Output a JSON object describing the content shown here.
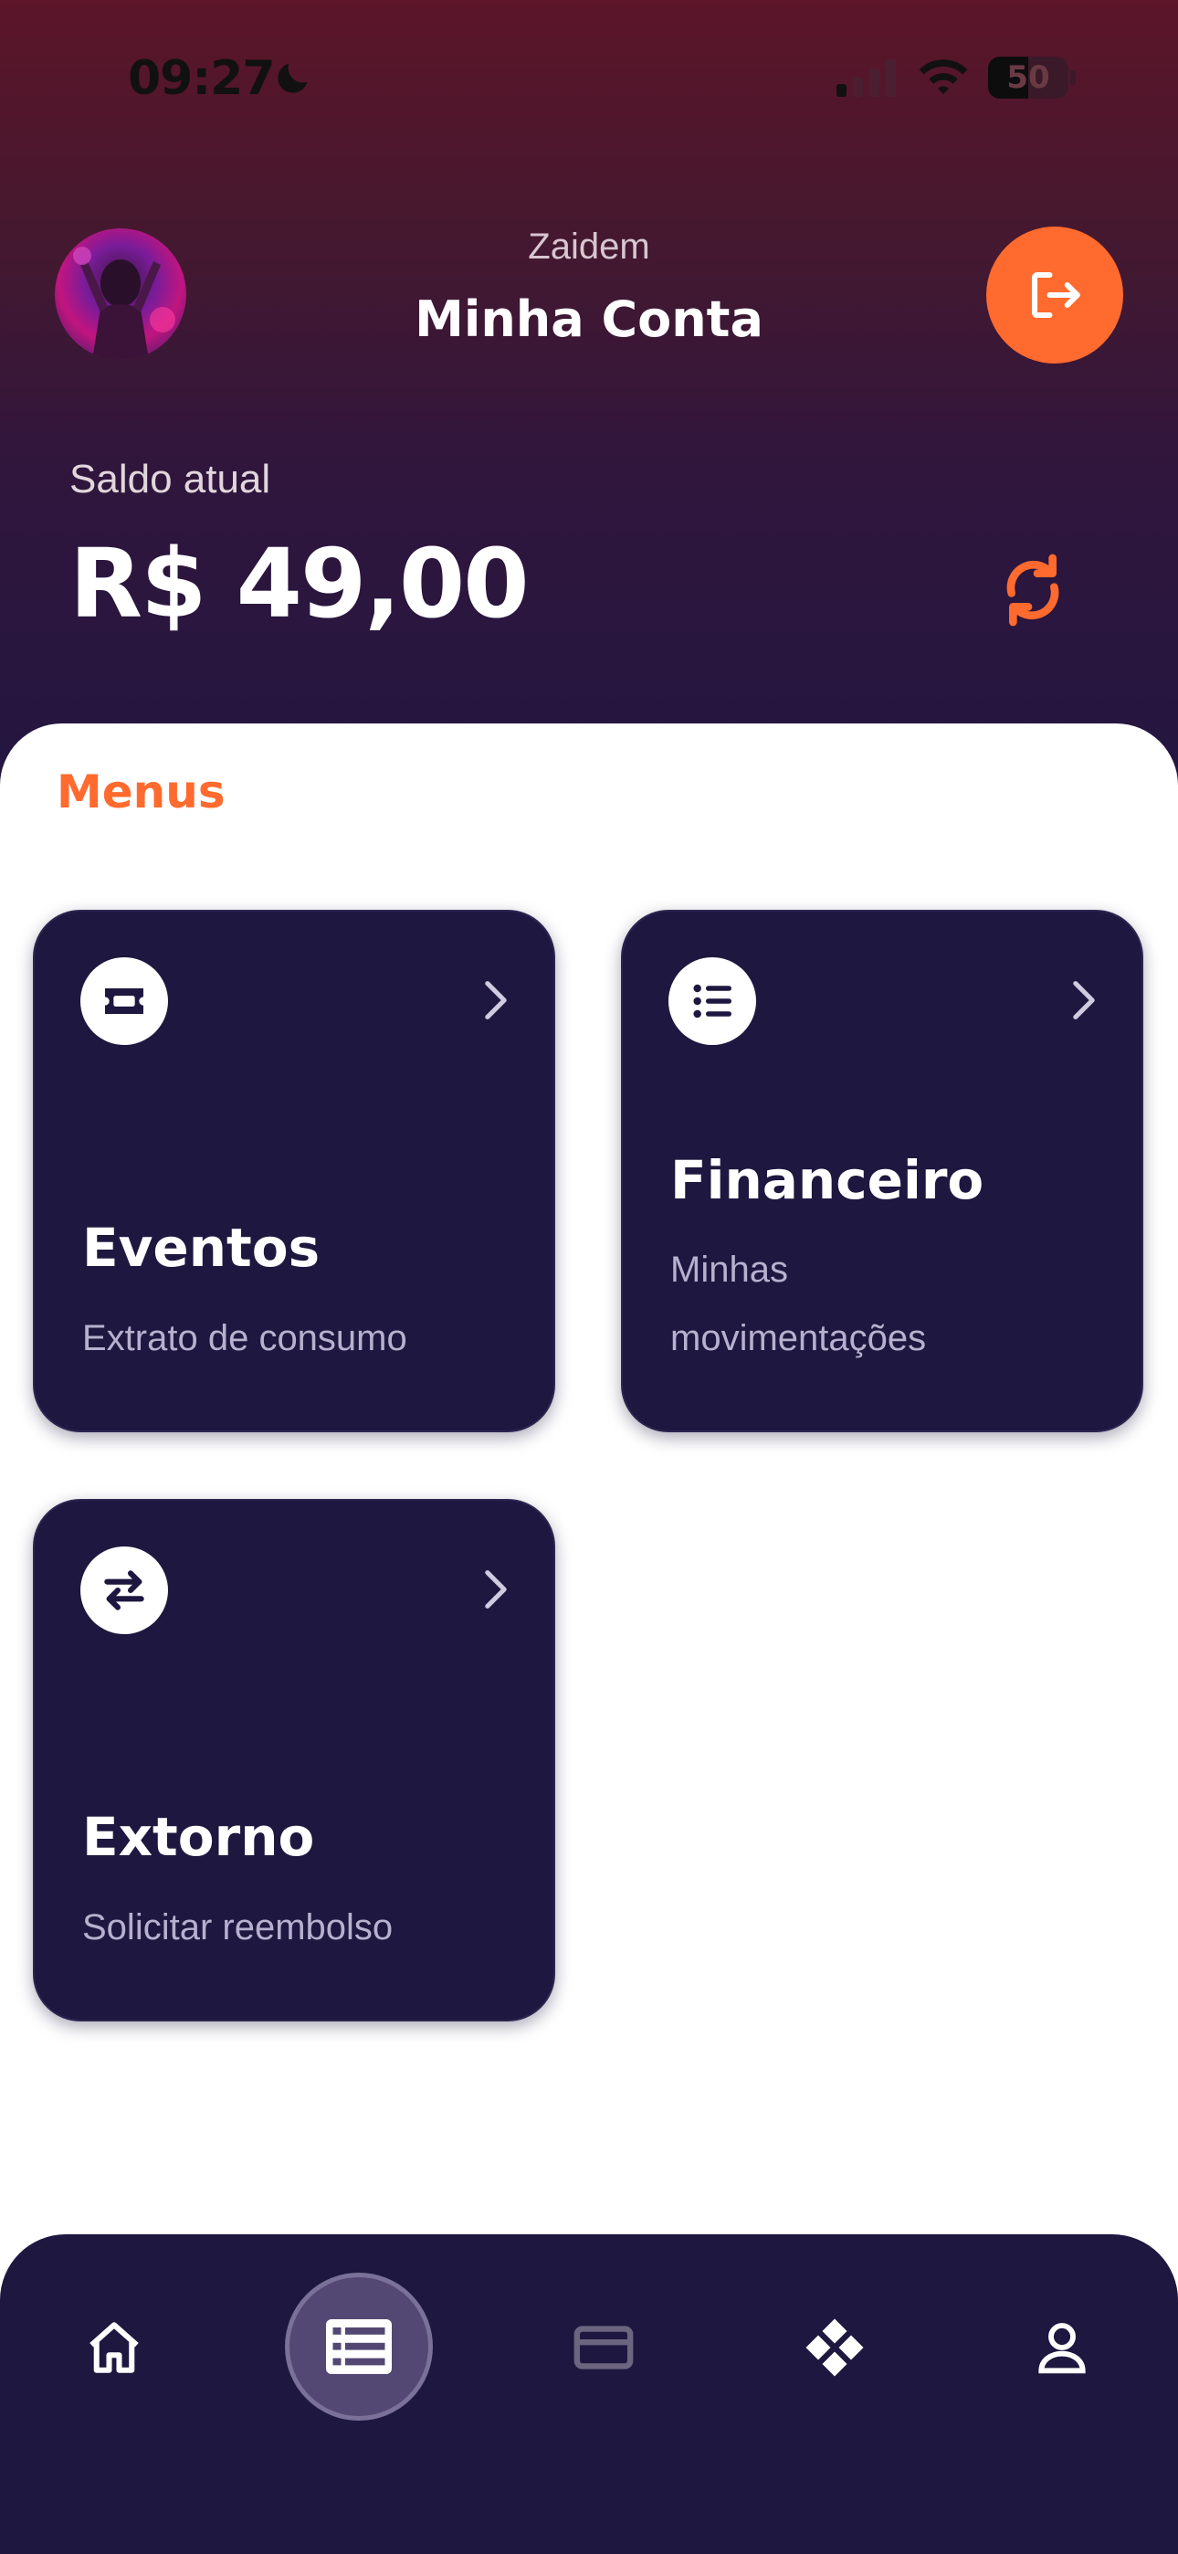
{
  "status_bar": {
    "time": "09:27",
    "battery": "50",
    "battery_level": 0.5
  },
  "header": {
    "username": "Zaidem",
    "title": "Minha Conta",
    "logout_icon": "logout-icon",
    "avatar_icon": "avatar"
  },
  "balance": {
    "label": "Saldo atual",
    "value": "R$ 49,00",
    "refresh_icon": "refresh-icon"
  },
  "menus": {
    "title": "Menus",
    "cards": [
      {
        "title": "Eventos",
        "subtitle": "Extrato de consumo",
        "icon": "ticket-icon"
      },
      {
        "title": "Financeiro",
        "subtitle": "Minhas movimentações",
        "icon": "list-icon"
      },
      {
        "title": "Extorno",
        "subtitle": "Solicitar reembolso",
        "icon": "swap-arrows-icon"
      }
    ]
  },
  "bottom_nav": {
    "items": [
      {
        "icon": "home-icon",
        "active": false
      },
      {
        "icon": "table-list-icon",
        "active": true
      },
      {
        "icon": "credit-card-icon",
        "active": false,
        "disabled": true
      },
      {
        "icon": "pix-icon",
        "active": false
      },
      {
        "icon": "user-icon",
        "active": false
      }
    ]
  },
  "colors": {
    "accent": "#ff6a2e",
    "card_bg": "#1e173f",
    "hero_top": "#5c1529",
    "hero_bottom": "#231640"
  }
}
